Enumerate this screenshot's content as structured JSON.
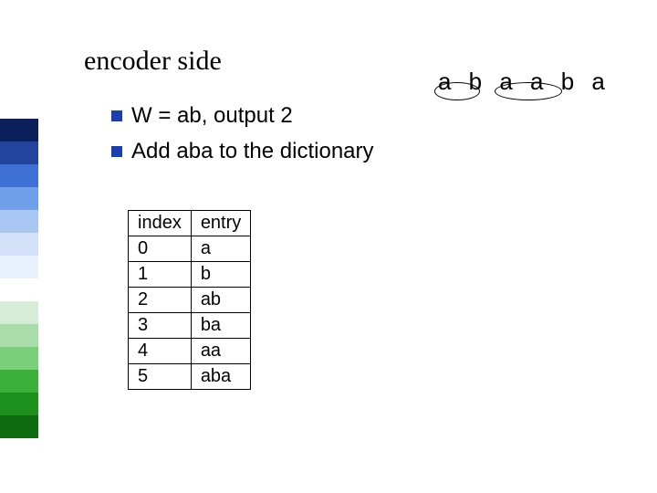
{
  "title": "encoder side",
  "corner_string": "a b a a b a",
  "bullets": [
    "W  = ab, output   2",
    "Add aba to the dictionary"
  ],
  "table": {
    "headers": [
      "index",
      "entry"
    ],
    "rows": [
      [
        "0",
        "a"
      ],
      [
        "1",
        "b"
      ],
      [
        "2",
        "ab"
      ],
      [
        "3",
        "ba"
      ],
      [
        "4",
        "aa"
      ],
      [
        "5",
        "aba"
      ]
    ]
  }
}
